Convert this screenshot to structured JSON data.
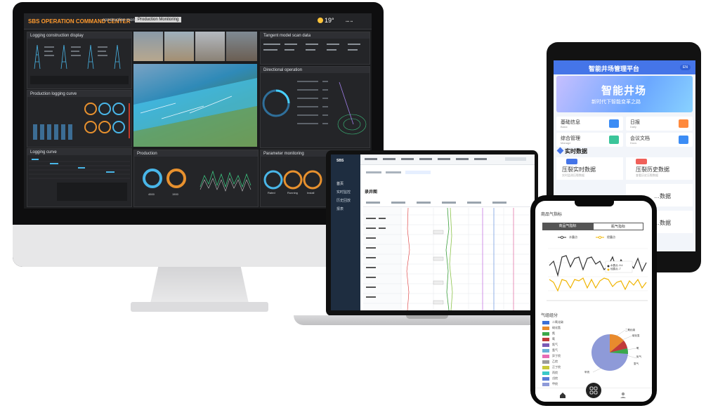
{
  "dashboard": {
    "title": "SBS OPERATION COMMAND CENTER",
    "tabs": [
      "construction monitoring",
      "Production Monitoring"
    ],
    "active_tab": "Production Monitoring",
    "temperature": "19°",
    "panels": {
      "logging_top": "Logging construction display",
      "production_logging": "Production logging curve",
      "logging_curve": "Logging curve",
      "scanned": "Tangent model scan data",
      "directional": "Directional operation",
      "production": "Production",
      "parameter": "Parameter monitoring"
    },
    "gauge_values": [
      "4500",
      "1500"
    ],
    "gauge_labels": [
      "Injection",
      "Production"
    ],
    "ring_labels": [
      "Rated",
      "Running",
      "Install"
    ]
  },
  "laptop": {
    "brand": "SBS",
    "menu": [
      "首页",
      "实时监控",
      "历史回放",
      "报表"
    ],
    "page_title": "录井图",
    "colors": {
      "sidebar": "#1e2d40"
    }
  },
  "tablet": {
    "title": "智能井场管理平台",
    "lang": "EN",
    "banner_title": "智能井场",
    "banner_subtitle": "新时代下智能变革之路",
    "cards": [
      {
        "label": "基础信息",
        "sub": "Basic",
        "color": "#3b8cf5"
      },
      {
        "label": "日报",
        "sub": "Daily",
        "color": "#ff8a3d"
      },
      {
        "label": "综合管理",
        "sub": "Manage",
        "color": "#3bc59a"
      },
      {
        "label": "会议文档",
        "sub": "Docs",
        "color": "#3b8cf5"
      }
    ],
    "realtime_title": "实时数据",
    "big_cards": [
      {
        "label": "压裂实时数据",
        "sub": "实时监测压裂数据"
      },
      {
        "label": "压裂历史数据",
        "sub": "查看历史压裂数据"
      },
      {
        "label": "…数据",
        "sub": ""
      },
      {
        "label": "…数据",
        "sub": ""
      }
    ]
  },
  "phone": {
    "header": "商品气指标",
    "segments": [
      "商品气指标",
      "瓶气指标"
    ],
    "legend": [
      "水露点",
      "烃露点"
    ],
    "point_labels": [
      "水露点:-5.4",
      "烃露点:-7"
    ],
    "pie_title": "气组组分",
    "components": [
      {
        "name": "二氧化碳",
        "color": "#3b6fd8"
      },
      {
        "name": "硫化氢",
        "color": "#e88a2d"
      },
      {
        "name": "氮",
        "color": "#3aa84a"
      },
      {
        "name": "氧",
        "color": "#c13a3a"
      },
      {
        "name": "氦气",
        "color": "#7a5bb5"
      },
      {
        "name": "氢气",
        "color": "#6bb0d8"
      },
      {
        "name": "异丁烷",
        "color": "#e86bb5"
      },
      {
        "name": "乙烷",
        "color": "#9b9b9b"
      },
      {
        "name": "正丁烷",
        "color": "#c9c93a"
      },
      {
        "name": "丙烷",
        "color": "#3ac9c9"
      },
      {
        "name": "戊烷",
        "color": "#5a7bd8"
      },
      {
        "name": "甲烷",
        "color": "#8e9ad8"
      }
    ],
    "pie_labels": [
      "二氧化碳",
      "硫化氢",
      "氧",
      "氦气",
      "氢气",
      "甲烷"
    ],
    "colors": {
      "water": "#333333",
      "hydrocarbon": "#f0b400"
    }
  }
}
